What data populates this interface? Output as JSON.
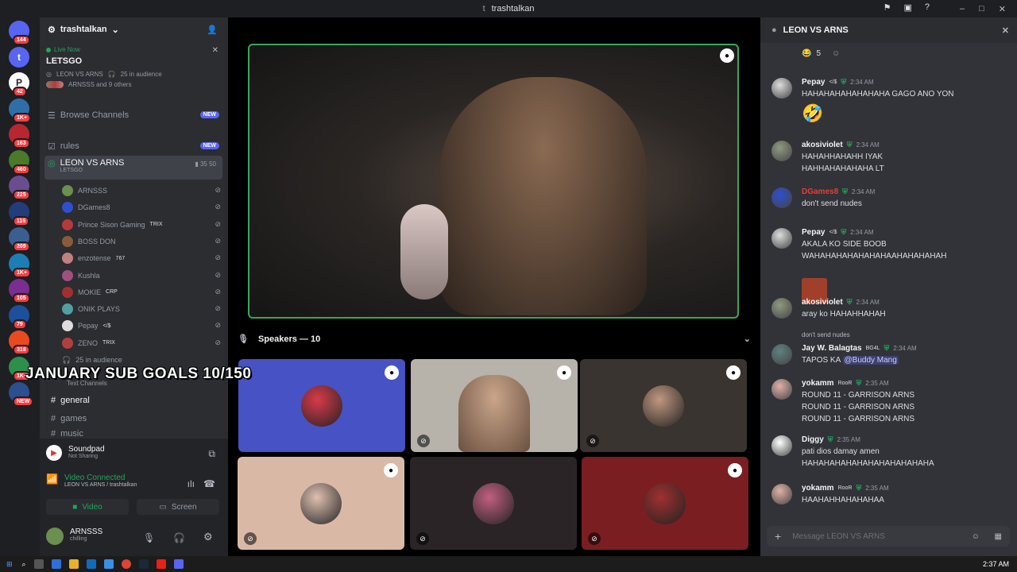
{
  "window": {
    "title": "trashtalkan",
    "title_icon": "t"
  },
  "guilds": [
    {
      "badge": "144",
      "color": "#5865f2",
      "letter": ""
    },
    {
      "badge": "",
      "color": "#5865f2",
      "letter": "t"
    },
    {
      "badge": "42",
      "color": "#ffffff",
      "letter": "P"
    },
    {
      "badge": "1K+",
      "color": "#2f6fa8",
      "letter": ""
    },
    {
      "badge": "163",
      "color": "#b8272f",
      "letter": ""
    },
    {
      "badge": "460",
      "color": "#4b7a2a",
      "letter": ""
    },
    {
      "badge": "225",
      "color": "#6a4d8f",
      "letter": ""
    },
    {
      "badge": "116",
      "color": "#233c7a",
      "letter": ""
    },
    {
      "badge": "209",
      "color": "#3a5f8f",
      "letter": ""
    },
    {
      "badge": "1K+",
      "color": "#1b7fb5",
      "letter": ""
    },
    {
      "badge": "105",
      "color": "#7a2e8f",
      "letter": ""
    },
    {
      "badge": "79",
      "color": "#1d4f9c",
      "letter": ""
    },
    {
      "badge": "318",
      "color": "#e84b1e",
      "letter": ""
    },
    {
      "badge": "1K+",
      "color": "#2e8f4d",
      "letter": ""
    },
    {
      "badge": "NEW",
      "color": "#2b4f8f",
      "letter": ""
    }
  ],
  "server": {
    "name": "trashtalkan"
  },
  "live": {
    "status": "Live Now",
    "title": "LETSGO",
    "channel": "LEON VS ARNS",
    "audience": "25 in audience",
    "watchers": "ARNSSS and 9 others"
  },
  "channels": {
    "browse": "Browse Channels",
    "rules": "rules",
    "new_badge": "NEW",
    "voice_channel": "LEON VS ARNS",
    "voice_status": "LETSGO",
    "voice_count_a": "35",
    "voice_count_b": "50",
    "audience": "25 in audience",
    "category": "Text Channels",
    "text": [
      "general",
      "games",
      "music"
    ]
  },
  "members": [
    {
      "name": "ARNSSS",
      "tag": "",
      "color": "#6b8f4e"
    },
    {
      "name": "DGames8",
      "tag": "",
      "color": "#2f4fcf"
    },
    {
      "name": "Prince Sison Gaming",
      "tag": "TRIX",
      "color": "#b53a3a"
    },
    {
      "name": "BOSS DON",
      "tag": "",
      "color": "#8a5a3a"
    },
    {
      "name": "enzotense",
      "tag": "767",
      "color": "#c08080"
    },
    {
      "name": "Kushla",
      "tag": "",
      "color": "#a05080"
    },
    {
      "name": "MOKIE",
      "tag": "CRP",
      "color": "#a03030"
    },
    {
      "name": "ONIK PLAYS",
      "tag": "",
      "color": "#50a0a0"
    },
    {
      "name": "Pepay",
      "tag": "</$",
      "color": "#dddddd"
    },
    {
      "name": "ZENO",
      "tag": "TRIX",
      "color": "#b04040"
    }
  ],
  "overlay": {
    "text": "JANUARY SUB GOALS 10/150"
  },
  "user_panel": {
    "soundpad": "Soundpad",
    "soundpad_status": "Not Sharing",
    "connection": "Video Connected",
    "connection_detail": "LEON VS ARNS / trashtalkan",
    "video_btn": "Video",
    "screen_btn": "Screen",
    "username": "ARNSSS",
    "user_status": "chilling"
  },
  "stage": {
    "speakers_label": "Speakers — 10"
  },
  "tiles": [
    {
      "bg": "#4752c4",
      "avatar": "#d93a4a"
    },
    {
      "bg": "#b7b2aa",
      "avatar": ""
    },
    {
      "bg": "#3a3430",
      "avatar": "#c09880"
    },
    {
      "bg": "#d9b9a6",
      "avatar": "#e0c0b0"
    },
    {
      "bg": "#2a2426",
      "avatar": "#c06080"
    },
    {
      "bg": "#7a1e22",
      "avatar": "#a03030"
    }
  ],
  "chat": {
    "title": "LEON VS ARNS",
    "reaction_count": "5",
    "placeholder": "Message LEON VS ARNS",
    "messages": [
      {
        "author": "Pepay",
        "tag": "</$",
        "time": "2:34 AM",
        "lines": [
          "HAHAHAHAHAHAHAHA GAGO ANO YON"
        ],
        "author_color": "#f2f3f5",
        "avatar": "#dddddd"
      },
      {
        "author": "akosiviolet",
        "tag": "",
        "time": "2:34 AM",
        "lines": [
          "HAHAHHAHAHH IYAK",
          "HAHHAHAHAHAHA LT"
        ],
        "author_color": "#f2f3f5",
        "avatar": "#8f9a80"
      },
      {
        "author": "DGames8",
        "tag": "",
        "time": "2:34 AM",
        "lines": [
          "don't send nudes"
        ],
        "author_color": "#e0403a",
        "avatar": "#2f4fcf"
      },
      {
        "author": "Pepay",
        "tag": "</$",
        "time": "2:34 AM",
        "lines": [
          "AKALA KO SIDE BOOB",
          "WAHAHAHAHAHAHAHAAHAHAHAHAH"
        ],
        "author_color": "#f2f3f5",
        "avatar": "#dddddd"
      },
      {
        "author": "akosiviolet",
        "tag": "",
        "time": "2:34 AM",
        "lines": [
          "aray ko HAHAHHAHAH"
        ],
        "author_color": "#f2f3f5",
        "avatar": "#8f9a80"
      },
      {
        "author": "Jay W. Balagtas",
        "tag": "BG4L",
        "time": "2:34 AM",
        "reply": "don't send nudes",
        "lines": [
          "TAPOS KA "
        ],
        "mention": "@Buddy Mang",
        "author_color": "#f2f3f5",
        "avatar": "#608080"
      },
      {
        "author": "yokamm",
        "tag": "RooR",
        "time": "2:35 AM",
        "lines": [
          "ROUND 11 - GARRISON ARNS",
          "ROUND 11 - GARRISON ARNS",
          "ROUND 11 - GARRISON ARNS"
        ],
        "author_color": "#f2f3f5",
        "avatar": "#e0b0a8"
      },
      {
        "author": "Diggy",
        "tag": "",
        "time": "2:35 AM",
        "lines": [
          "pati dios damay amen",
          "HAHAHAHAHAHAHAHAHAHAHAHA"
        ],
        "author_color": "#f2f3f5",
        "avatar": "#ffffff"
      },
      {
        "author": "yokamm",
        "tag": "RooR",
        "time": "2:35 AM",
        "lines": [
          "HAAHAHHAHAHAHAA"
        ],
        "author_color": "#f2f3f5",
        "avatar": "#e0b0a8"
      }
    ]
  },
  "taskbar": {
    "time": "2:37 AM"
  }
}
